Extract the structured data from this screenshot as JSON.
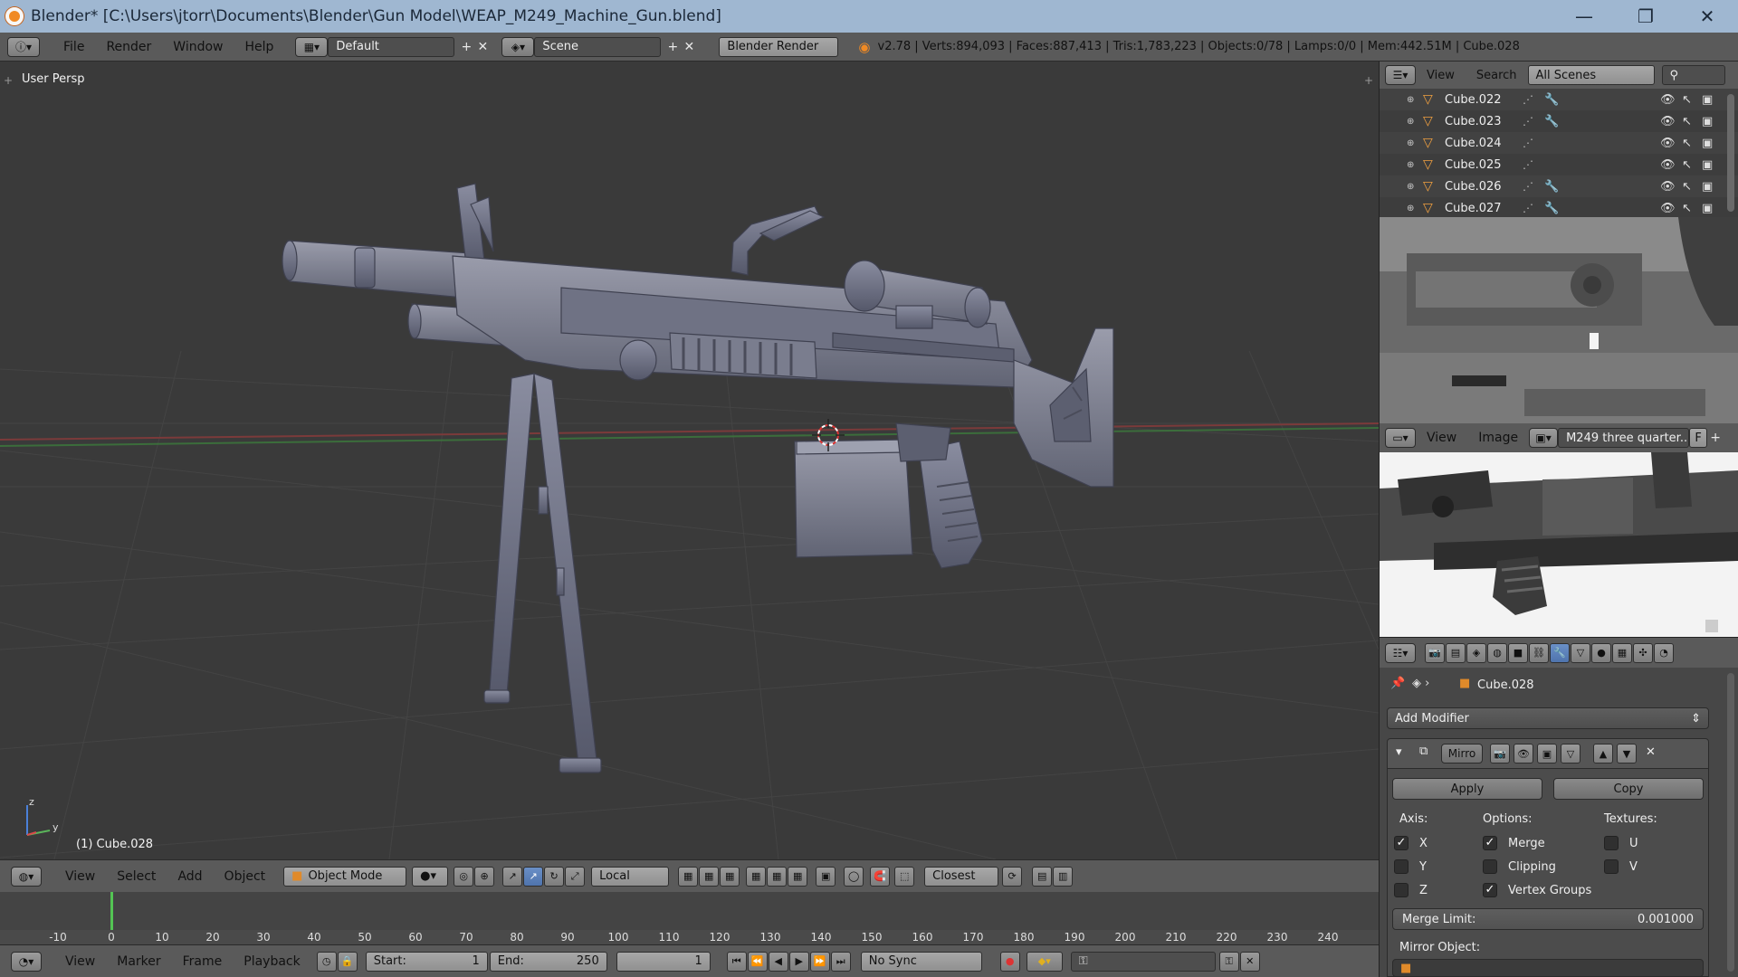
{
  "window": {
    "title": "Blender* [C:\\Users\\jtorr\\Documents\\Blender\\Gun Model\\WEAP_M249_Machine_Gun.blend]",
    "minimize": "—",
    "maximize": "❐",
    "close": "✕"
  },
  "info_header": {
    "menus": [
      "File",
      "Render",
      "Window",
      "Help"
    ],
    "layout": "Default",
    "scene": "Scene",
    "engine": "Blender Render",
    "stats": "v2.78 | Verts:894,093 | Faces:887,413 | Tris:1,783,223 | Objects:0/78 | Lamps:0/0 | Mem:442.51M | Cube.028"
  },
  "viewport": {
    "view_name": "User Persp",
    "active_object": "(1) Cube.028",
    "axis_labels": {
      "z": "z",
      "y": "y"
    }
  },
  "viewport_header": {
    "menus": [
      "View",
      "Select",
      "Add",
      "Object"
    ],
    "mode": "Object Mode",
    "orientation": "Local",
    "snap_target": "Closest"
  },
  "timeline": {
    "ticks": [
      "-10",
      "0",
      "10",
      "20",
      "30",
      "40",
      "50",
      "60",
      "70",
      "80",
      "90",
      "100",
      "110",
      "120",
      "130",
      "140",
      "150",
      "160",
      "170",
      "180",
      "190",
      "200",
      "210",
      "220",
      "230",
      "240"
    ],
    "menus": [
      "View",
      "Marker",
      "Frame",
      "Playback"
    ],
    "start_label": "Start:",
    "start": "1",
    "end_label": "End:",
    "end": "250",
    "current": "1",
    "sync": "No Sync"
  },
  "outliner": {
    "menus": [
      "View",
      "Search"
    ],
    "filter": "All Scenes",
    "items": [
      {
        "name": "Cube.022",
        "modifier": true
      },
      {
        "name": "Cube.023",
        "modifier": true
      },
      {
        "name": "Cube.024",
        "modifier": false
      },
      {
        "name": "Cube.025",
        "modifier": false
      },
      {
        "name": "Cube.026",
        "modifier": true
      },
      {
        "name": "Cube.027",
        "modifier": true
      }
    ]
  },
  "image_editor": {
    "menus": [
      "View",
      "Image"
    ],
    "image_name": "M249 three quarter...",
    "fake_user": "F"
  },
  "properties": {
    "object": "Cube.028",
    "add_modifier": "Add Modifier",
    "modifier_name": "Mirro",
    "apply": "Apply",
    "copy": "Copy",
    "axis_title": "Axis:",
    "options_title": "Options:",
    "textures_title": "Textures:",
    "axis": [
      {
        "label": "X",
        "checked": true
      },
      {
        "label": "Y",
        "checked": false
      },
      {
        "label": "Z",
        "checked": false
      }
    ],
    "options": [
      {
        "label": "Merge",
        "checked": true
      },
      {
        "label": "Clipping",
        "checked": false
      },
      {
        "label": "Vertex Groups",
        "checked": true
      }
    ],
    "textures": [
      {
        "label": "U",
        "checked": false
      },
      {
        "label": "V",
        "checked": false
      }
    ],
    "merge_limit_label": "Merge Limit:",
    "merge_limit": "0.001000",
    "mirror_object_label": "Mirror Object:"
  },
  "colors": {
    "title_bar": "#9fb7d1",
    "header": "#5a5a5a",
    "viewport_bg": "#3a3a3a",
    "model": "#6b6e80",
    "timeline_cursor": "#53c453"
  }
}
